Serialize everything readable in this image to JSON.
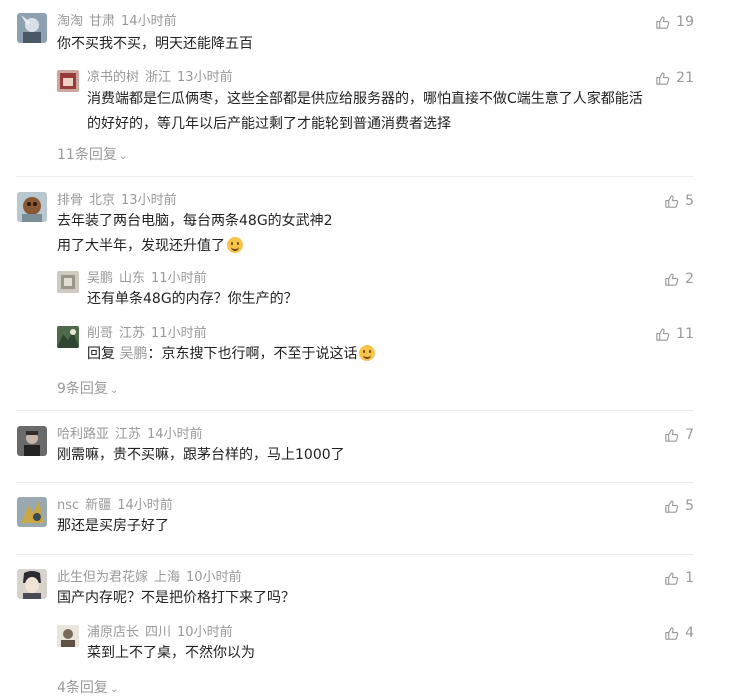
{
  "comments": [
    {
      "user": "淘淘",
      "location": "甘肃",
      "time": "14小时前",
      "lines": [
        "你不买我不买，明天还能降五百"
      ],
      "likes": "19",
      "replies": [
        {
          "user": "凉书的树",
          "location": "浙江",
          "time": "13小时前",
          "lines": [
            "消费端都是仨瓜俩枣，这些全部都是供应给服务器的，哪怕直接不做C端生意了人家都能活",
            "的好好的，等几年以后产能过剩了才能轮到普通消费者选择"
          ],
          "likes": "21"
        }
      ],
      "more": "11条回复"
    },
    {
      "user": "排骨",
      "location": "北京",
      "time": "13小时前",
      "lines": [
        "去年装了两台电脑，每台两条48G的女武神2",
        "用了大半年，发现还升值了"
      ],
      "likes": "5",
      "replies": [
        {
          "user": "吴鹏",
          "location": "山东",
          "time": "11小时前",
          "lines": [
            "还有单条48G的内存？你生产的？"
          ],
          "likes": "2"
        },
        {
          "user": "削哥",
          "location": "江苏",
          "time": "11小时前",
          "reply_prefix": "回复",
          "reply_to": "吴鹏",
          "reply_sep": "：",
          "lines": [
            "京东搜下也行啊，不至于说这话"
          ],
          "likes": "11"
        }
      ],
      "more": "9条回复"
    },
    {
      "user": "哈利路亚",
      "location": "江苏",
      "time": "14小时前",
      "lines": [
        "刚需嘛，贵不买嘛，跟茅台样的，马上1000了"
      ],
      "likes": "7"
    },
    {
      "user": "nsc",
      "location": "新疆",
      "time": "14小时前",
      "lines": [
        "那还是买房子好了"
      ],
      "likes": "5"
    },
    {
      "user": "此生但为君花嫁",
      "location": "上海",
      "time": "10小时前",
      "lines": [
        "国产内存呢？不是把价格打下来了吗？"
      ],
      "likes": "1",
      "replies": [
        {
          "user": "浦原店长",
          "location": "四川",
          "time": "10小时前",
          "lines": [
            "菜到上不了桌，不然你以为"
          ],
          "likes": "4"
        }
      ],
      "more": "4条回复"
    }
  ],
  "icons": {
    "like": "thumbs-up-icon",
    "expand": "chevron-down-icon",
    "emoji_smile": "smile-emoji-icon",
    "emoji_laugh": "laugh-emoji-icon"
  },
  "colors": {
    "meta": "#999999",
    "text": "#222222",
    "divider": "#eeeeee"
  }
}
